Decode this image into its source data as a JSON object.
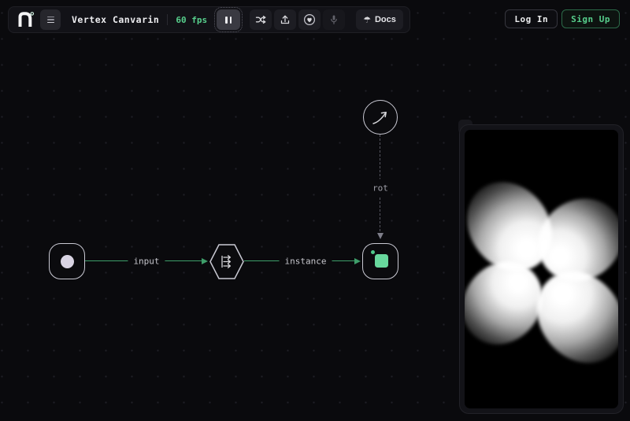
{
  "toolbar": {
    "title": "Vertex Canvarin",
    "fps": "60 fps",
    "docs": "Docs"
  },
  "icons": {
    "umbrella": "☂",
    "logo_degree": "°"
  },
  "auth": {
    "login": "Log In",
    "signup": "Sign Up"
  },
  "graph": {
    "input_edge_label": "input",
    "instance_edge_label": "instance",
    "rot_edge_label": "rot"
  },
  "colors": {
    "background": "#0a0a0d",
    "accent_green": "#57cf8c",
    "edge_green": "#3e9e6a",
    "node_border": "#c9c9d3",
    "node_fill_green": "#68d89d",
    "node_dot_lavender": "#d9d4e3"
  }
}
